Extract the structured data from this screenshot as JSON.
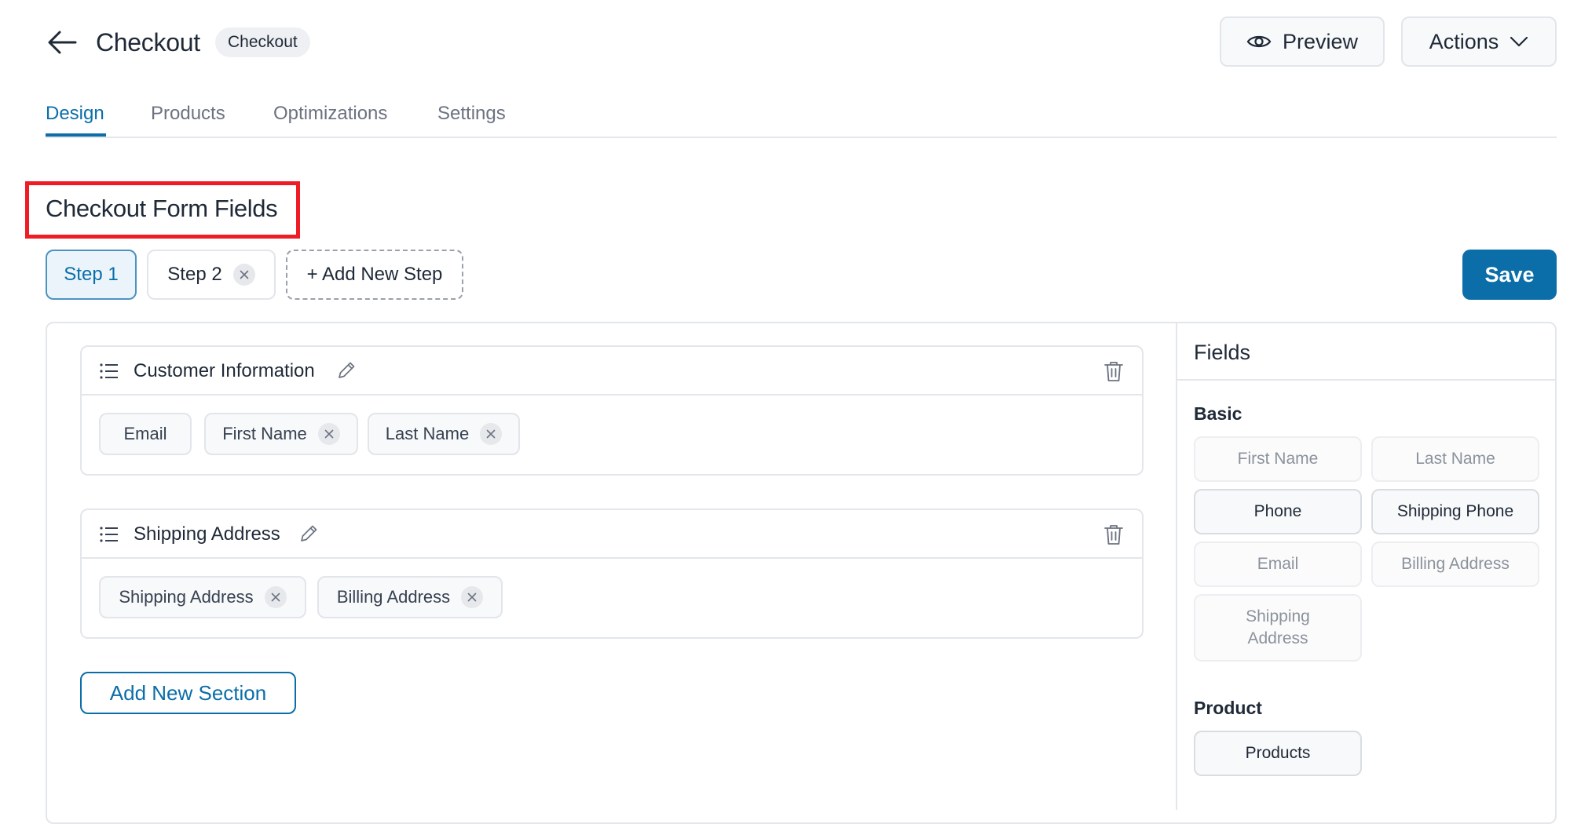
{
  "header": {
    "title": "Checkout",
    "tag": "Checkout",
    "preview_label": "Preview",
    "actions_label": "Actions"
  },
  "tabs": [
    {
      "label": "Design",
      "active": true
    },
    {
      "label": "Products",
      "active": false
    },
    {
      "label": "Optimizations",
      "active": false
    },
    {
      "label": "Settings",
      "active": false
    }
  ],
  "section_title": "Checkout Form Fields",
  "steps": {
    "step1": "Step 1",
    "step2": "Step 2",
    "add": "+ Add New Step",
    "save": "Save"
  },
  "sections": [
    {
      "title": "Customer Information",
      "fields": [
        {
          "label": "Email",
          "removable": false
        },
        {
          "label": "First Name",
          "removable": true
        },
        {
          "label": "Last Name",
          "removable": true
        }
      ]
    },
    {
      "title": "Shipping Address",
      "fields": [
        {
          "label": "Shipping Address",
          "removable": true
        },
        {
          "label": "Billing Address",
          "removable": true
        }
      ]
    }
  ],
  "add_section_label": "Add New Section",
  "sidebar": {
    "title": "Fields",
    "groups": [
      {
        "title": "Basic",
        "items": [
          {
            "label": "First Name",
            "enabled": false
          },
          {
            "label": "Last Name",
            "enabled": false
          },
          {
            "label": "Phone",
            "enabled": true
          },
          {
            "label": "Shipping Phone",
            "enabled": true
          },
          {
            "label": "Email",
            "enabled": false
          },
          {
            "label": "Billing Address",
            "enabled": false
          },
          {
            "label": "Shipping Address",
            "enabled": false
          }
        ]
      },
      {
        "title": "Product",
        "items": [
          {
            "label": "Products",
            "enabled": true
          }
        ]
      }
    ]
  },
  "colors": {
    "accent": "#0b6ea8",
    "highlight_box": "#ee1c25"
  },
  "icons": [
    "arrow-left-icon",
    "eye-icon",
    "chevron-down-icon",
    "close-icon",
    "list-icon",
    "pencil-icon",
    "trash-icon"
  ]
}
